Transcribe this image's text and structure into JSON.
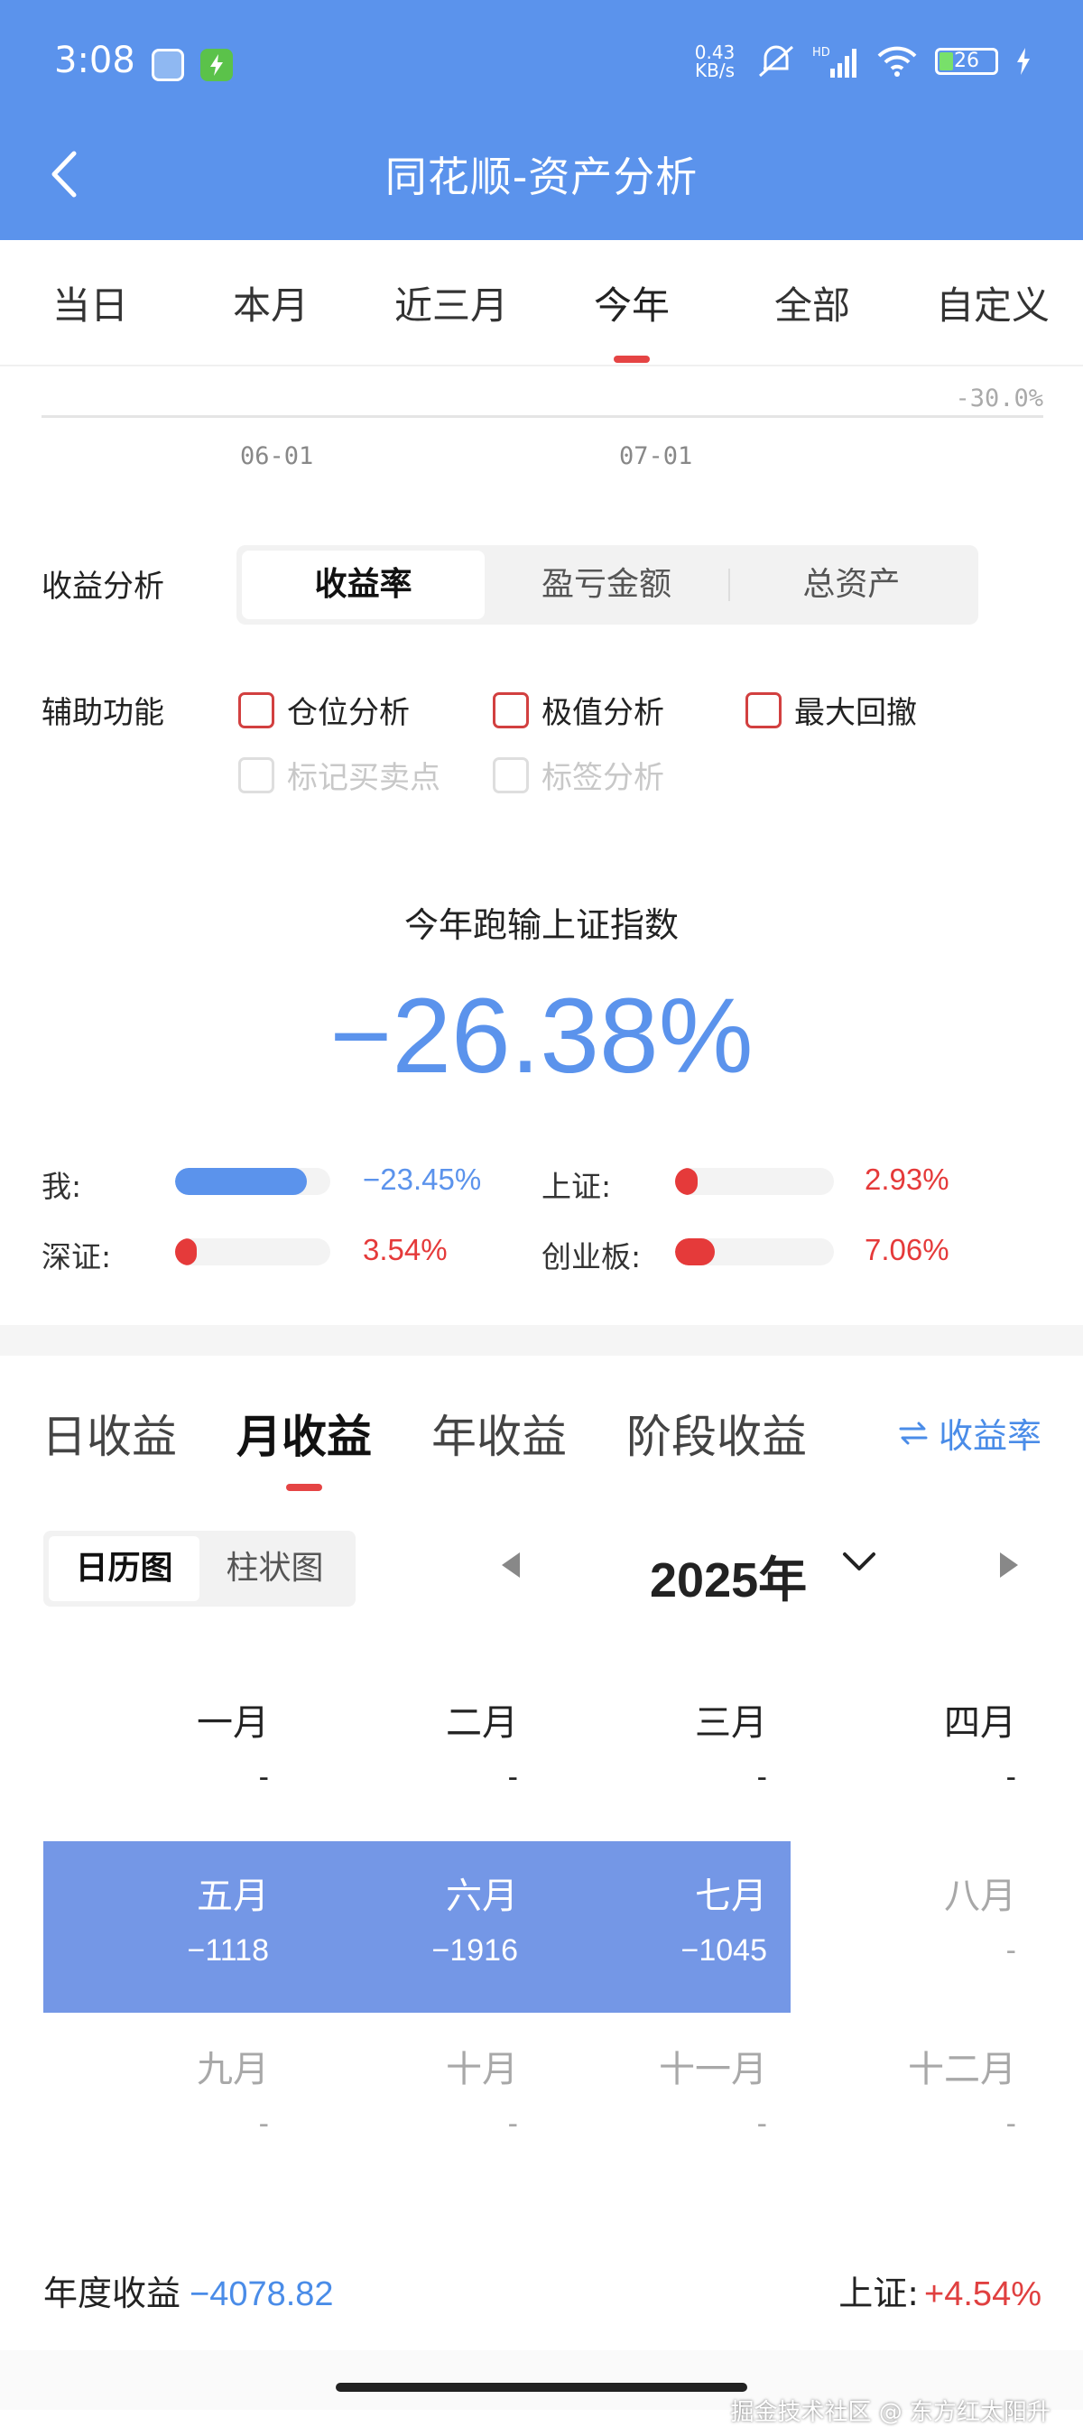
{
  "status_bar": {
    "time": "3:08",
    "network_speed": "0.43\nKB/s",
    "battery": "26",
    "icons": [
      "compass-app-icon",
      "charge-app-icon",
      "mute-icon",
      "signal-icon",
      "wifi-icon",
      "battery-icon",
      "charging-icon"
    ]
  },
  "header": {
    "title": "同花顺-资产分析",
    "bg_color": "#5b93ec"
  },
  "period_tabs": [
    "当日",
    "本月",
    "近三月",
    "今年",
    "全部",
    "自定义"
  ],
  "period_active_index": 3,
  "chart_stub": {
    "y_tick": "-30.0%",
    "x_ticks": [
      "06-01",
      "07-01"
    ]
  },
  "analysis": {
    "label": "收益分析",
    "options": [
      "收益率",
      "盈亏金额",
      "总资产"
    ],
    "active_index": 0
  },
  "aux": {
    "label": "辅助功能",
    "checks": [
      {
        "label": "仓位分析",
        "checked": false,
        "disabled": false
      },
      {
        "label": "极值分析",
        "checked": false,
        "disabled": false
      },
      {
        "label": "最大回撤",
        "checked": false,
        "disabled": false
      },
      {
        "label": "标记买卖点",
        "checked": false,
        "disabled": true
      },
      {
        "label": "标签分析",
        "checked": false,
        "disabled": true
      }
    ]
  },
  "comparison": {
    "title": "今年跑输上证指数",
    "value": "−26.38%",
    "items": [
      {
        "label": "我:",
        "value": "−23.45%",
        "fill_fraction": 0.85,
        "color": "#5b93ec"
      },
      {
        "label": "上证:",
        "value": "2.93%",
        "fill_fraction": 0.1,
        "color": "#e53a3a"
      },
      {
        "label": "深证:",
        "value": "3.54%",
        "fill_fraction": 0.12,
        "color": "#e53a3a"
      },
      {
        "label": "创业板:",
        "value": "7.06%",
        "fill_fraction": 0.25,
        "color": "#e53a3a"
      }
    ]
  },
  "returns_tabs": [
    "日收益",
    "月收益",
    "年收益",
    "阶段收益"
  ],
  "returns_active_index": 1,
  "rate_toggle": "收益率",
  "view_toggle": {
    "options": [
      "日历图",
      "柱状图"
    ],
    "active_index": 0
  },
  "year": "2025年",
  "calendar": [
    {
      "month": "一月",
      "value": "-"
    },
    {
      "month": "二月",
      "value": "-"
    },
    {
      "month": "三月",
      "value": "-"
    },
    {
      "month": "四月",
      "value": "-"
    },
    {
      "month": "五月",
      "value": "−1118"
    },
    {
      "month": "六月",
      "value": "−1916"
    },
    {
      "month": "七月",
      "value": "−1045"
    },
    {
      "month": "八月",
      "value": "-"
    },
    {
      "month": "九月",
      "value": "-"
    },
    {
      "month": "十月",
      "value": "-"
    },
    {
      "month": "十一月",
      "value": "-"
    },
    {
      "month": "十二月",
      "value": "-"
    }
  ],
  "annual": {
    "label": "年度收益",
    "value": "−4078.82"
  },
  "sh_annual": {
    "label": "上证:",
    "value": "+4.54%"
  },
  "watermark": "掘金技术社区 @ 东方红太阳升"
}
